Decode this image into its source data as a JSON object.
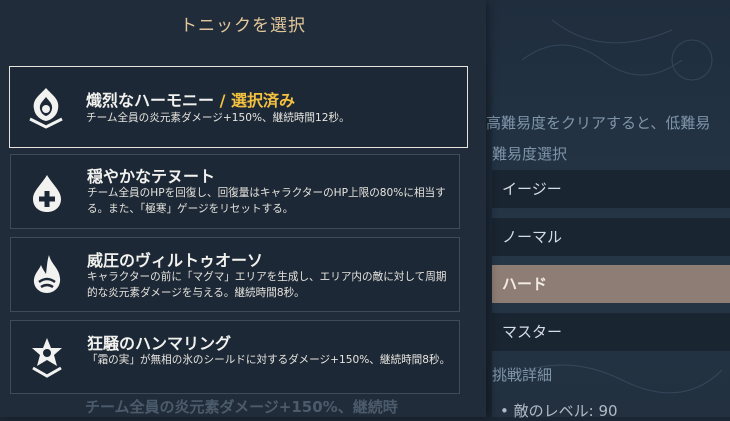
{
  "dialog": {
    "title": "トニックを選択",
    "options": [
      {
        "name": "熾烈なハーモニー",
        "selected_tag": " / 選択済み",
        "desc": "チーム全員の炎元素ダメージ+150%、継続時間12秒。",
        "icon": "pyro-flame-emblem-icon"
      },
      {
        "name": "穏やかなテヌート",
        "desc": "チーム全員のHPを回復し、回復量はキャラクターのHP上限の80%に相当する。また、「極寒」ゲージをリセットする。",
        "icon": "healing-drop-icon"
      },
      {
        "name": "威圧のヴィルトゥオーソ",
        "desc": "キャラクターの前に「マグマ」エリアを生成し、エリア内の敵に対して周期的な炎元素ダメージを与える。継続時間8秒。",
        "icon": "magma-flame-icon"
      },
      {
        "name": "狂騒のハンマリング",
        "desc": "「霜の実」が無相の氷のシールドに対するダメージ+150%、継続時間8秒。",
        "icon": "star-shield-icon"
      }
    ]
  },
  "background": {
    "hint": "高難易度をクリアすると、低難易",
    "difficulty_label": "難易度選択",
    "difficulties": [
      "イージー",
      "ノーマル",
      "ハード",
      "マスター"
    ],
    "selected_difficulty": "ハード",
    "details_label": "挑戦詳細",
    "enemy_level": "• 敵のレベル: 90",
    "ghost_text": "チーム全員の炎元素ダメージ+150%、継続時"
  },
  "colors": {
    "title": "#e3c79a",
    "selected_tag": "#f2c041",
    "selected_difficulty_bg": "#8d7d74"
  }
}
